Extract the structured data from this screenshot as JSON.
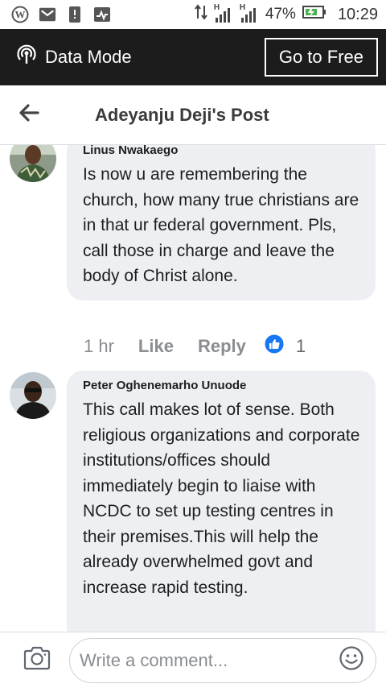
{
  "status_bar": {
    "network_h_label": "H",
    "network_h2_label": "H",
    "battery_percent": "47%",
    "time": "10:29"
  },
  "data_bar": {
    "mode_label": "Data Mode",
    "go_free_label": "Go to Free"
  },
  "header": {
    "title": "Adeyanju Deji's Post"
  },
  "comments": [
    {
      "author": "Linus Nwakaego",
      "text": "Is now u are remembering the church, how many true christians are in that ur federal government. Pls, call those in charge and leave the body of Christ alone.",
      "time": "1 hr",
      "like_label": "Like",
      "reply_label": "Reply",
      "reaction_count": "1"
    },
    {
      "author": "Peter Oghenemarho Unuode",
      "text": "This call makes lot  of sense. Both religious organizations and corporate institutions/offices should immediately begin to liaise with NCDC to set up testing centres in their premises.This will  help the already overwhelmed govt and increase rapid testing."
    }
  ],
  "composer": {
    "placeholder": "Write a comment..."
  },
  "colors": {
    "data_bar_bg": "#1c1c1c",
    "bubble_bg": "#eeeff2",
    "like_blue": "#1877f2",
    "battery_green": "#4caf50"
  }
}
